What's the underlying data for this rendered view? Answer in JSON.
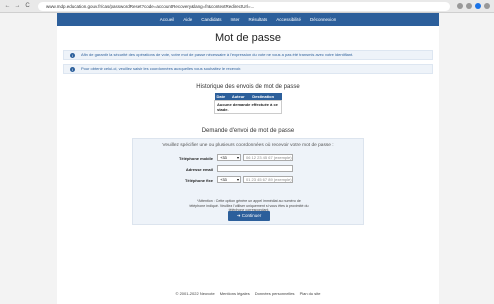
{
  "browser": {
    "back": "←",
    "forward": "→",
    "reload": "C",
    "url": "www.mdp.education.gouv.fr/cas/passwordReset?code=accountRecovery&lang=fr&contextRedirectUrl=..."
  },
  "nav": {
    "items": [
      "Accueil",
      "Aide",
      "Candidats",
      "Inter",
      "Résultats",
      "Accessibilité",
      "Déconnexion"
    ]
  },
  "page": {
    "title": "Mot de passe",
    "info1": "Afin de garantir la sécurité des opérations de vote, votre mot de passe nécessaire à l'expression du vote ne vous a pas été transmis avec votre identifiant.",
    "info2": "Pour obtenir celui-ci, veuillez saisir les coordonnées auxquelles vous souhaitez le recevoir."
  },
  "history": {
    "title": "Historique des envois de mot de passe",
    "columns": [
      "Date",
      "Auteur",
      "Destination"
    ],
    "empty": "Aucune demande effectuée à ce stade."
  },
  "form": {
    "title": "Demande d'envoi de mot de passe",
    "intro": "Veuillez spécifier une ou plusieurs coordonnées où recevoir votre mot de passe :",
    "mobile_label": "Téléphone mobile",
    "mobile_prefix": "+33",
    "mobile_placeholder": "06 12 23 45 67 (exemple)",
    "email_label": "Adresse email",
    "email_value": "",
    "fixed_label": "Téléphone fixe",
    "fixed_prefix": "+33",
    "fixed_placeholder": "01 23 45 67 89 (exemple)",
    "warning": "*Attention : Cette option génère un appel immédiat au numéro de téléphone indiqué. Veuillez l'utiliser uniquement si vous êtes à proximité du téléphone correspondant.",
    "submit": "Continuer"
  },
  "footer": {
    "links": [
      "© 2001-2022 Neovote",
      "Mentions légales",
      "Données personnelles",
      "Plan du site"
    ]
  }
}
